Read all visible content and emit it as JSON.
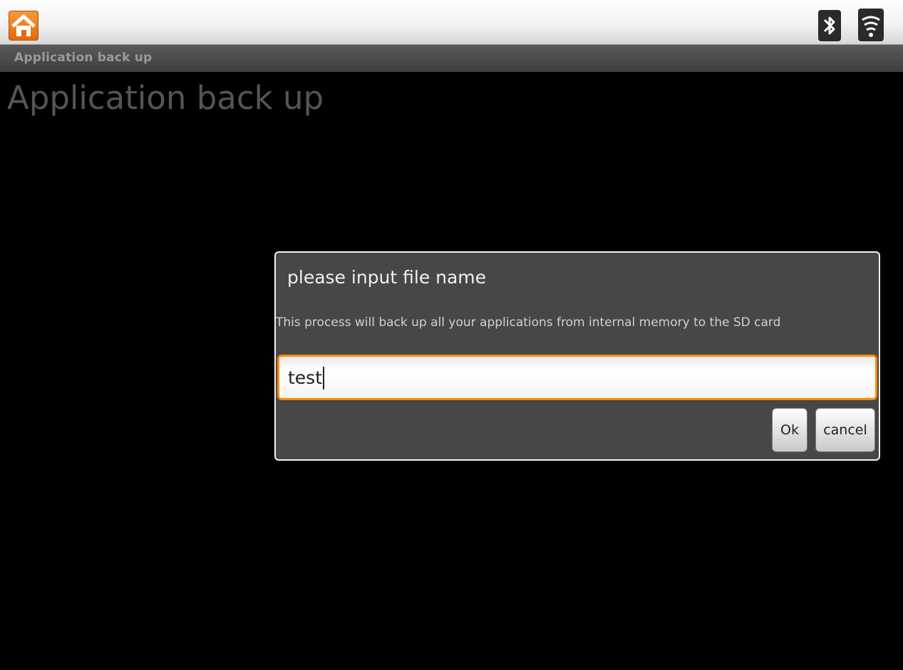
{
  "status_bar": {
    "home_icon": "home-icon",
    "bluetooth_icon": "bluetooth-icon",
    "wifi_icon": "wifi-icon"
  },
  "app": {
    "title_bar": "Application back up",
    "page_title": "Application back up"
  },
  "dialog": {
    "title": "please input file name",
    "message": "This process will back up all your applications from internal memory to the SD card",
    "input_value": "test",
    "ok_label": "Ok",
    "cancel_label": "cancel",
    "accent_color": "#ff8a00"
  }
}
